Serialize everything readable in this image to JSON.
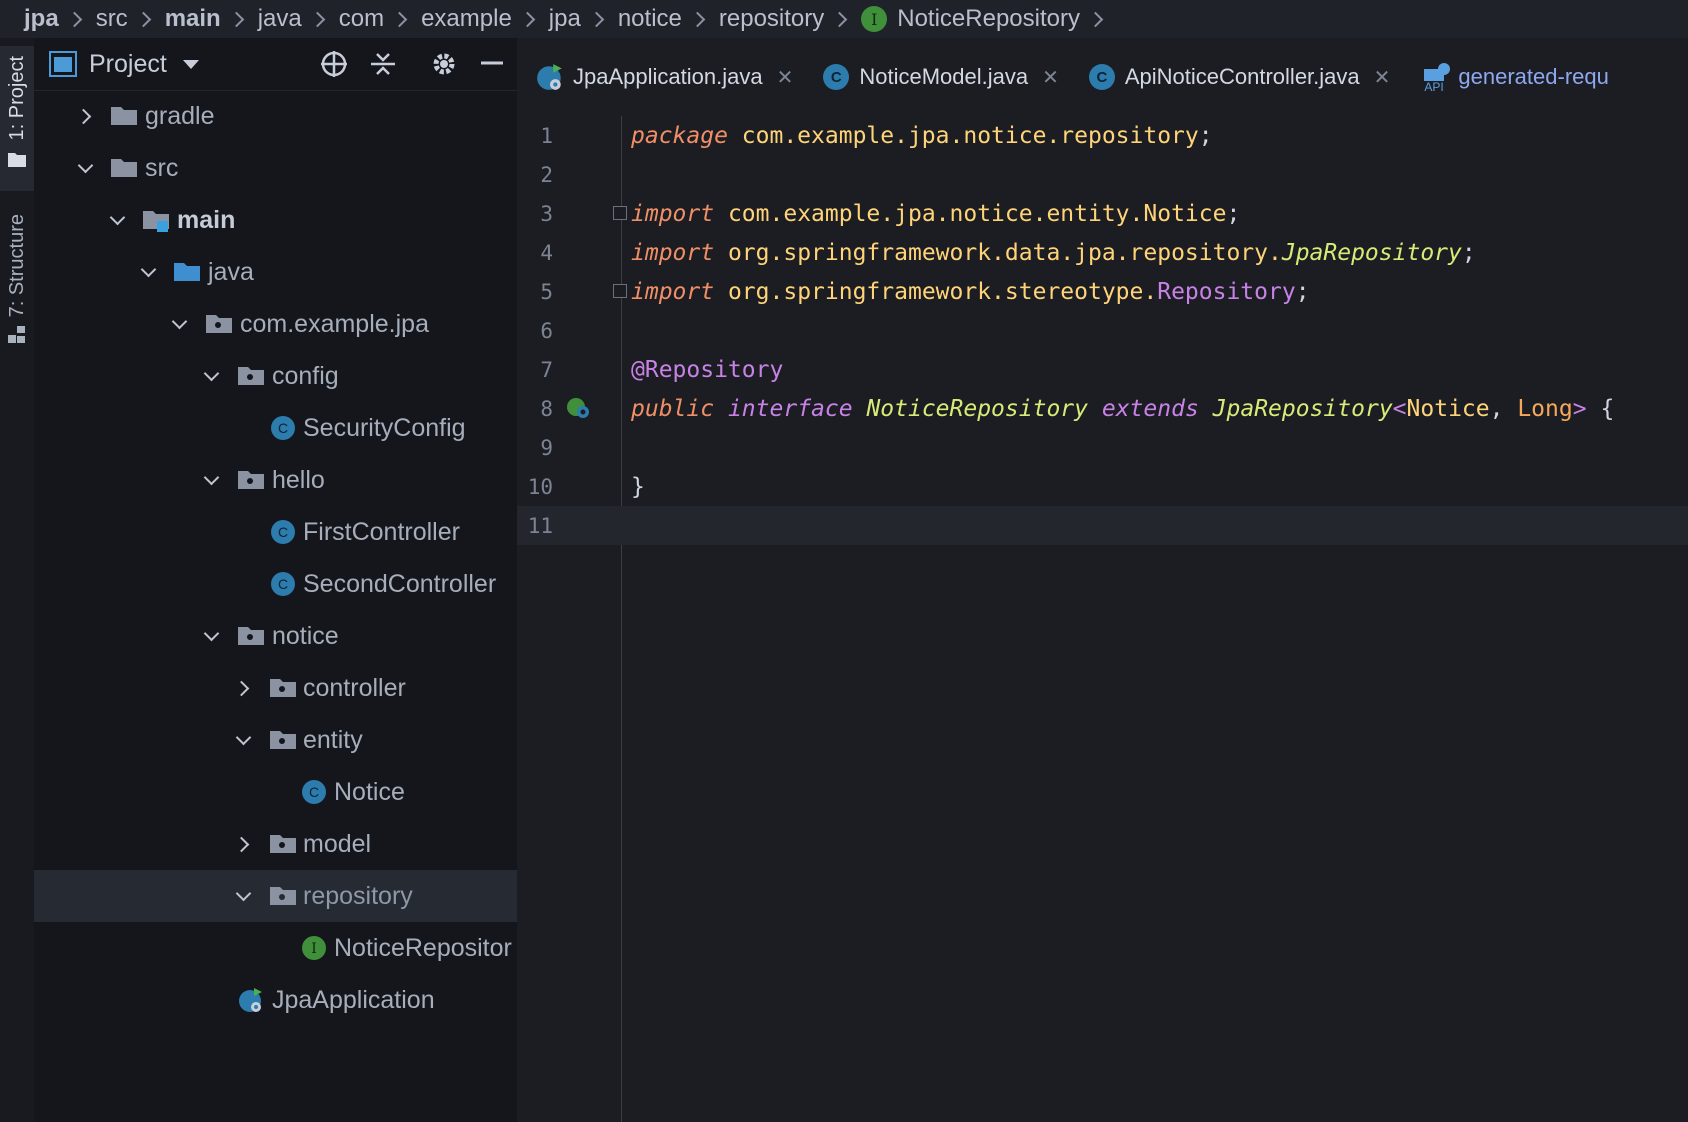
{
  "breadcrumb": [
    {
      "label": "jpa",
      "bold": true
    },
    {
      "label": "src",
      "bold": false
    },
    {
      "label": "main",
      "bold": true
    },
    {
      "label": "java",
      "bold": false
    },
    {
      "label": "com",
      "bold": false
    },
    {
      "label": "example",
      "bold": false
    },
    {
      "label": "jpa",
      "bold": false
    },
    {
      "label": "notice",
      "bold": false
    },
    {
      "label": "repository",
      "bold": false
    },
    {
      "label": "NoticeRepository",
      "bold": false,
      "icon": "interface-icon"
    }
  ],
  "interface_badge": "I",
  "class_badge": "C",
  "tool_windows": {
    "project": "1: Project",
    "structure": "7: Structure"
  },
  "project_panel": {
    "title": "Project",
    "tree": [
      {
        "label": "gradle",
        "level": 0,
        "expanded": false,
        "icon": "folder-icon"
      },
      {
        "label": "src",
        "level": 0,
        "expanded": true,
        "icon": "folder-icon"
      },
      {
        "label": "main",
        "level": 1,
        "expanded": true,
        "icon": "source-root-folder-icon",
        "bold": true
      },
      {
        "label": "java",
        "level": 2,
        "expanded": true,
        "icon": "java-source-folder-icon"
      },
      {
        "label": "com.example.jpa",
        "level": 3,
        "expanded": true,
        "icon": "package-icon"
      },
      {
        "label": "config",
        "level": 4,
        "expanded": true,
        "icon": "package-icon"
      },
      {
        "label": "SecurityConfig",
        "level": 5,
        "icon": "class-icon"
      },
      {
        "label": "hello",
        "level": 4,
        "expanded": true,
        "icon": "package-icon"
      },
      {
        "label": "FirstController",
        "level": 5,
        "icon": "class-icon"
      },
      {
        "label": "SecondController",
        "level": 5,
        "icon": "class-icon"
      },
      {
        "label": "notice",
        "level": 4,
        "expanded": true,
        "icon": "package-icon"
      },
      {
        "label": "controller",
        "level": 5,
        "expanded": false,
        "icon": "package-icon"
      },
      {
        "label": "entity",
        "level": 5,
        "expanded": true,
        "icon": "package-icon"
      },
      {
        "label": "Notice",
        "level": 6,
        "icon": "class-icon"
      },
      {
        "label": "model",
        "level": 5,
        "expanded": false,
        "icon": "package-icon"
      },
      {
        "label": "repository",
        "level": 5,
        "expanded": true,
        "icon": "package-icon",
        "selected": true,
        "dim": true
      },
      {
        "label": "NoticeRepositor",
        "level": 6,
        "icon": "interface-icon"
      },
      {
        "label": "JpaApplication",
        "level": 4,
        "icon": "spring-app-icon"
      }
    ]
  },
  "tabs": [
    {
      "label": "JpaApplication.java",
      "icon": "spring-app-icon",
      "close": "✕"
    },
    {
      "label": "NoticeModel.java",
      "icon": "class-icon",
      "close": "✕"
    },
    {
      "label": "ApiNoticeController.java",
      "icon": "class-icon",
      "close": "✕"
    },
    {
      "label": "generated-requ",
      "icon": "api-file-icon"
    }
  ],
  "api_icon_label": "API",
  "editor": {
    "line_numbers": [
      "1",
      "2",
      "3",
      "4",
      "5",
      "6",
      "7",
      "8",
      "9",
      "10",
      "11"
    ],
    "current_line": "11",
    "code": {
      "l1_kw": "package",
      "l1_pkg": "com.example.jpa.notice.repository",
      "semicolon": ";",
      "import_kw": "import",
      "l3_pkg": "com.example.jpa.notice.entity.Notice",
      "l4_pkg": "org.springframework.data.jpa.repository.",
      "l4_cls": "JpaRepository",
      "l5_pkg": "org.springframework.stereotype.",
      "l5_cls": "Repository",
      "l7_ann": "@Repository",
      "l8_public": "public",
      "l8_interface": "interface",
      "l8_name": "NoticeRepository",
      "l8_extends": "extends",
      "l8_super": "JpaRepository",
      "l8_lt": "<",
      "l8_t1": "Notice",
      "l8_comma": ", ",
      "l8_t2": "Long",
      "l8_gt": ">",
      "l8_brace": "{",
      "l10_brace": "}"
    }
  }
}
